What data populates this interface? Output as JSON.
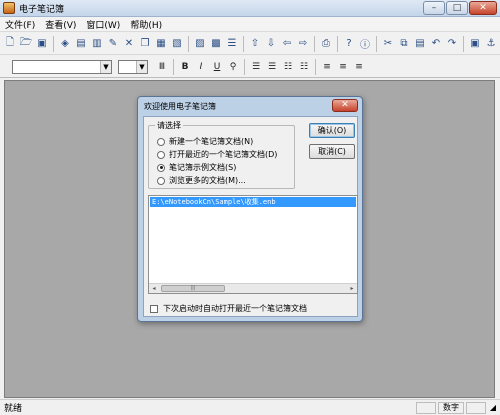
{
  "window": {
    "title": "电子笔记簿",
    "minimize": "–",
    "maximize": "□",
    "close": "✕"
  },
  "menu": [
    "文件(F)",
    "查看(V)",
    "窗口(W)",
    "帮助(H)"
  ],
  "toolbar_icons": [
    "new-doc-icon",
    "open-folder-icon",
    "save-icon",
    "sep",
    "tag-icon",
    "notebook-icon",
    "book-icon",
    "pen-icon",
    "delete-icon",
    "copy-icon",
    "doc-icon",
    "doc2-icon",
    "sep",
    "import-icon",
    "export-icon",
    "list-icon",
    "sep",
    "up-icon",
    "down-icon",
    "left-icon",
    "right-icon",
    "sep",
    "print-icon",
    "sep",
    "help-icon",
    "sep",
    "cut-icon",
    "copy2-icon",
    "paste-icon",
    "undo-icon",
    "redo-icon",
    "sep",
    "image-icon",
    "anchor-icon"
  ],
  "format_buttons": [
    "Ⅲ",
    "B",
    "I",
    "U",
    "⚲",
    "☰",
    "☰",
    "☷",
    "☷",
    "≡",
    "≡",
    "≡"
  ],
  "status": {
    "text": "就绪",
    "pane_num": "数字"
  },
  "dialog": {
    "title": "欢迎使用电子笔记簿",
    "close": "✕",
    "group_label": "请选择",
    "options": [
      {
        "label": "新建一个笔记簿文档(N)",
        "checked": false
      },
      {
        "label": "打开最近的一个笔记簿文档(D)",
        "checked": false
      },
      {
        "label": "笔记簿示例文档(S)",
        "checked": true
      },
      {
        "label": "浏览更多的文档(M)...",
        "checked": false
      }
    ],
    "ok_button": "确认(O)",
    "cancel_button": "取消(C)",
    "file_list": [
      "E:\\eNotebookCn\\Sample\\收集.enb"
    ],
    "scroll_left": "◂",
    "scroll_right": "▸",
    "scroll_thumb": "|||",
    "auto_open_label": "下次启动时自动打开最近一个笔记簿文档"
  }
}
